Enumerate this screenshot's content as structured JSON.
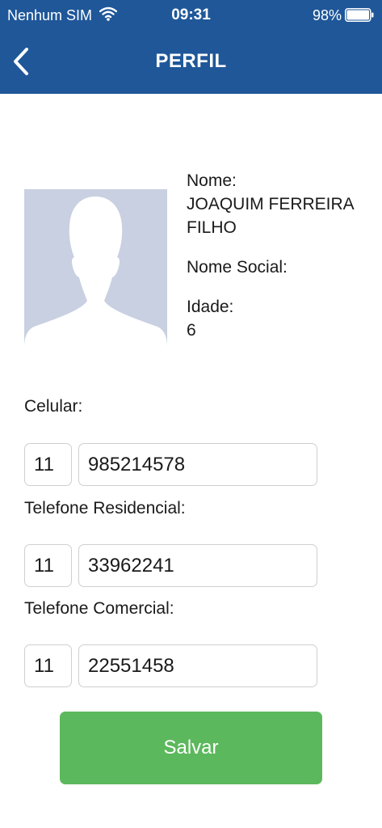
{
  "status_bar": {
    "carrier": "Nenhum SIM",
    "time": "09:31",
    "battery": "98%"
  },
  "header": {
    "title": "PERFIL",
    "back_icon": "chevron-left-icon",
    "background_color": "#1f5799"
  },
  "profile": {
    "avatar_icon": "person-silhouette-icon",
    "name_label": "Nome:",
    "name_line1": "JOAQUIM FERREIRA",
    "name_line2": "FILHO",
    "social_name_label": "Nome Social:",
    "social_name_value": "",
    "age_label": "Idade:",
    "age_value": "6"
  },
  "phones": {
    "mobile": {
      "label": "Celular:",
      "area_code": "11",
      "number": "985214578"
    },
    "home": {
      "label": "Telefone Residencial:",
      "area_code": "11",
      "number": "33962241"
    },
    "work": {
      "label": "Telefone Comercial:",
      "area_code": "11",
      "number": "22551458"
    }
  },
  "actions": {
    "save_label": "Salvar",
    "save_color": "#5cb85c"
  }
}
